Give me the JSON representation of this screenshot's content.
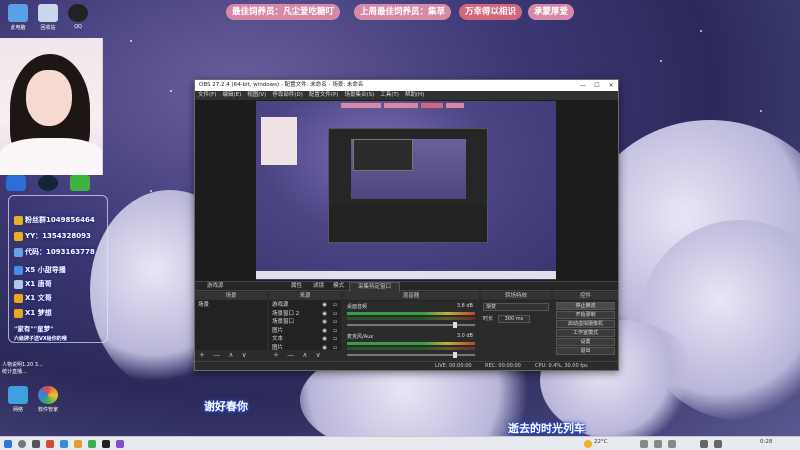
{
  "desktop_icons": [
    {
      "label": "此电脑",
      "icon": "computer-icon",
      "color": "#5aa0e6"
    },
    {
      "label": "回收站",
      "icon": "recycle-bin-icon",
      "color": "#c8d8ea"
    },
    {
      "label": "QQ",
      "icon": "qq-penguin-icon",
      "color": "#222222"
    }
  ],
  "desktop_icons_bottom": [
    {
      "label": "网络",
      "icon": "network-icon",
      "color": "#3fa0e0"
    },
    {
      "label": "软件管家",
      "icon": "software-manager-icon",
      "color": "#e04a4a"
    }
  ],
  "small_note": {
    "line1": "人物说明1.20 3...",
    "line2": "统计直播..."
  },
  "banners": [
    {
      "text": "最佳饲养员：凡尘爱吃糖叮",
      "color": "#d78aa8"
    },
    {
      "text": "上周最佳饲养员：集草",
      "color": "#d78aa8"
    },
    {
      "text": "万幸得以相识",
      "color": "#d0687e"
    },
    {
      "text": "承蒙厚爱",
      "color": "#d78aa8"
    }
  ],
  "left_panel": {
    "rows": [
      "粉丝群1049856464",
      "YY：1354328093",
      "代码：1093163778",
      "X5  小甜导播",
      "X1  唐哥",
      "X1  文哥",
      "X1  梦想"
    ],
    "footer1": "\"家有\"\"星梦\"",
    "footer2": "六级牌子送VX给你的哦"
  },
  "obs": {
    "title": "OBS 27.2.4 (64-bit, windows) - 配置文件: 未命名 - 场景: 未命名",
    "window_controls": [
      "—",
      "☐",
      "✕"
    ],
    "menu": [
      "文件(F)",
      "编辑(E)",
      "视图(V)",
      "停靠部件(D)",
      "配置文件(P)",
      "场景集合(S)",
      "工具(T)",
      "帮助(H)"
    ],
    "source_toolbar": {
      "selected": "游戏源",
      "properties": "属性",
      "filters": "滤镜",
      "mode_label": "模式",
      "mode_value": "采集特定窗口"
    },
    "docks": {
      "scenes": {
        "header": "场景",
        "items": [
          "场景"
        ]
      },
      "sources": {
        "header": "来源",
        "items": [
          "游戏源",
          "场景窗口 2",
          "场景窗口",
          "图片",
          "文本",
          "图片",
          "图片"
        ]
      },
      "mixer": {
        "header": "混音器",
        "tracks": [
          {
            "name": "桌面音频",
            "db": "3.8 dB"
          },
          {
            "name": "麦克风/Aux",
            "db": "3.0 dB"
          }
        ]
      },
      "transitions": {
        "header": "转场特效",
        "type": "渐变",
        "duration_label": "时长",
        "duration": "300 ms"
      },
      "controls": {
        "header": "控件",
        "buttons": [
          "停止推流",
          "开始录制",
          "启动虚拟摄像机",
          "工作室模式",
          "设置",
          "退出"
        ]
      }
    },
    "dock_footer": "+ — ∧ ∨",
    "status": {
      "live": "LIVE: 00:00:00",
      "rec": "REC: 00:00:00",
      "cpu": "CPU: 0.4%, 30.00 fps"
    }
  },
  "subtitles": {
    "left": "谢好春你",
    "right": "逝去的时光列车"
  },
  "taskbar": {
    "weather": "22°C",
    "time": "0:28"
  }
}
